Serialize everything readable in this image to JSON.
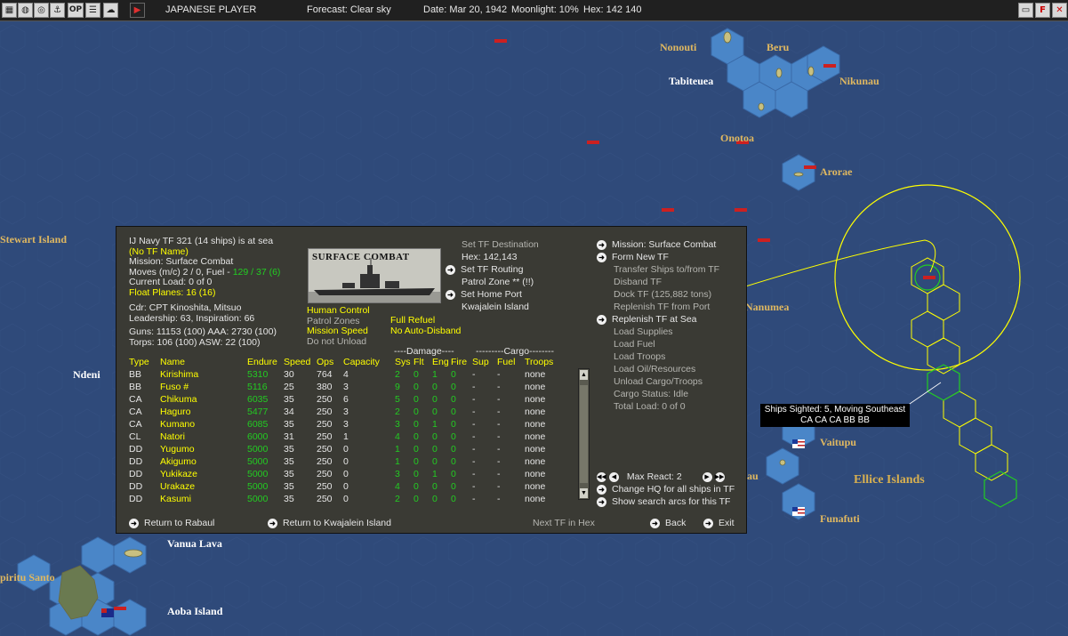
{
  "topbar": {
    "player": "JAPANESE PLAYER",
    "forecast": "Forecast: Clear sky",
    "date": "Date: Mar 20, 1942",
    "moonlight": "Moonlight: 10%",
    "hex": "Hex: 142 140",
    "icons_left": [
      "map-icon",
      "globe-icon",
      "target-icon",
      "ship-icon",
      "op-icon",
      "list-icon",
      "weather-icon",
      "flag-icon"
    ],
    "op_label": "OP",
    "icons_right": [
      "restore-icon",
      "flag-icon",
      "close-icon"
    ]
  },
  "map": {
    "labels": {
      "nonouti": "Nonouti",
      "beru": "Beru",
      "tabiteuea": "Tabiteuea",
      "nikunau": "Nikunau",
      "onotoa": "Onotoa",
      "arorae": "Arorae",
      "stewart": "Stewart Island",
      "nanumea": "Nanumea",
      "ndeni": "Ndeni",
      "vaitupu": "Vaitupu",
      "ellice": "Ellice Islands",
      "funafuti": "Funafuti",
      "vanua_lava": "Vanua Lava",
      "espiritu": "piritu Santo",
      "aoba": "Aoba Island",
      "au": "au"
    },
    "sighting": {
      "line1": "Ships Sighted: 5, Moving Southeast",
      "line2": "CA CA CA BB BB"
    }
  },
  "dialog": {
    "header": {
      "title": "IJ Navy TF 321 (14 ships) is at sea",
      "name": "(No TF Name)",
      "mission": "Mission: Surface Combat",
      "moves_prefix": "Moves (m/c) 2 / 0, Fuel - ",
      "fuel": "129 / 37 (6)",
      "load": "Current Load: 0 of 0",
      "float_planes": "Float Planes: 16 (16)",
      "cdr": "Cdr: CPT  Kinoshita, Mitsuo",
      "leadership": "Leadership: 63, Inspiration: 66",
      "guns": "Guns: 11153 (100) AAA: 2730 (100)",
      "torps": "Torps: 106 (100)   ASW: 22 (100)"
    },
    "mission_image_title": "SURFACE COMBAT",
    "controls": {
      "human_control": "Human Control",
      "patrol_zones": "Patrol Zones",
      "mission_speed": "Mission Speed",
      "do_not_unload": "Do not Unload",
      "full_refuel": "Full Refuel",
      "no_auto_disband": "No Auto-Disband"
    },
    "destination": {
      "set_dest": "Set TF Destination",
      "hex": "Hex: 142,143",
      "set_routing": "Set TF Routing",
      "patrol_zone": "Patrol Zone ** (!!)",
      "set_home": "Set Home Port",
      "home": "Kwajalein Island"
    },
    "right_menu": [
      {
        "label": "Mission: Surface Combat",
        "active": true
      },
      {
        "label": "Form New TF",
        "active": true
      },
      {
        "label": "Transfer Ships to/from TF",
        "active": false
      },
      {
        "label": "Disband TF",
        "active": false
      },
      {
        "label": "Dock TF (125,882 tons)",
        "active": false
      },
      {
        "label": "Replenish TF from Port",
        "active": false
      },
      {
        "label": "Replenish TF at Sea",
        "active": true
      },
      {
        "label": "Load Supplies",
        "active": false
      },
      {
        "label": "Load Fuel",
        "active": false
      },
      {
        "label": "Load Troops",
        "active": false
      },
      {
        "label": "Load Oil/Resources",
        "active": false
      },
      {
        "label": "Unload Cargo/Troops",
        "active": false
      },
      {
        "label": "Cargo Status: Idle",
        "active": false
      },
      {
        "label": "Total Load: 0 of 0",
        "active": false
      }
    ],
    "max_react": "Max React: 2",
    "change_hq": "Change HQ for all ships in TF",
    "show_arcs": "Show search arcs for this TF",
    "table": {
      "group_damage": "----Damage----",
      "group_cargo": "---------Cargo--------",
      "headers": [
        "Type",
        "Name",
        "Endure",
        "Speed",
        "Ops",
        "Capacity",
        "Sys",
        "Flt",
        "Eng",
        "Fire",
        "Sup",
        "Fuel",
        "Troops"
      ],
      "rows": [
        [
          "BB",
          "Kirishima",
          "5310",
          "30",
          "764",
          "4",
          "2",
          "0",
          "1",
          "0",
          "-",
          "-",
          "none"
        ],
        [
          "BB",
          "Fuso #",
          "5116",
          "25",
          "380",
          "3",
          "9",
          "0",
          "0",
          "0",
          "-",
          "-",
          "none"
        ],
        [
          "CA",
          "Chikuma",
          "6035",
          "35",
          "250",
          "6",
          "5",
          "0",
          "0",
          "0",
          "-",
          "-",
          "none"
        ],
        [
          "CA",
          "Haguro",
          "5477",
          "34",
          "250",
          "3",
          "2",
          "0",
          "0",
          "0",
          "-",
          "-",
          "none"
        ],
        [
          "CA",
          "Kumano",
          "6085",
          "35",
          "250",
          "3",
          "3",
          "0",
          "1",
          "0",
          "-",
          "-",
          "none"
        ],
        [
          "CL",
          "Natori",
          "6000",
          "31",
          "250",
          "1",
          "4",
          "0",
          "0",
          "0",
          "-",
          "-",
          "none"
        ],
        [
          "DD",
          "Yugumo",
          "5000",
          "35",
          "250",
          "0",
          "1",
          "0",
          "0",
          "0",
          "-",
          "-",
          "none"
        ],
        [
          "DD",
          "Akigumo",
          "5000",
          "35",
          "250",
          "0",
          "1",
          "0",
          "0",
          "0",
          "-",
          "-",
          "none"
        ],
        [
          "DD",
          "Yukikaze",
          "5000",
          "35",
          "250",
          "0",
          "3",
          "0",
          "1",
          "0",
          "-",
          "-",
          "none"
        ],
        [
          "DD",
          "Urakaze",
          "5000",
          "35",
          "250",
          "0",
          "4",
          "0",
          "0",
          "0",
          "-",
          "-",
          "none"
        ],
        [
          "DD",
          "Kasumi",
          "5000",
          "35",
          "250",
          "0",
          "2",
          "0",
          "0",
          "0",
          "-",
          "-",
          "none"
        ]
      ]
    },
    "footer": {
      "return_rabaul": "Return to Rabaul",
      "return_kwaj": "Return to Kwajalein Island",
      "next_tf": "Next TF in Hex",
      "back": "Back",
      "exit": "Exit"
    }
  },
  "colors": {
    "ocean": "#2f4a7a",
    "hex_light": "#4a86c8",
    "highlight": "#ffff00",
    "range_green": "#22cc22"
  }
}
